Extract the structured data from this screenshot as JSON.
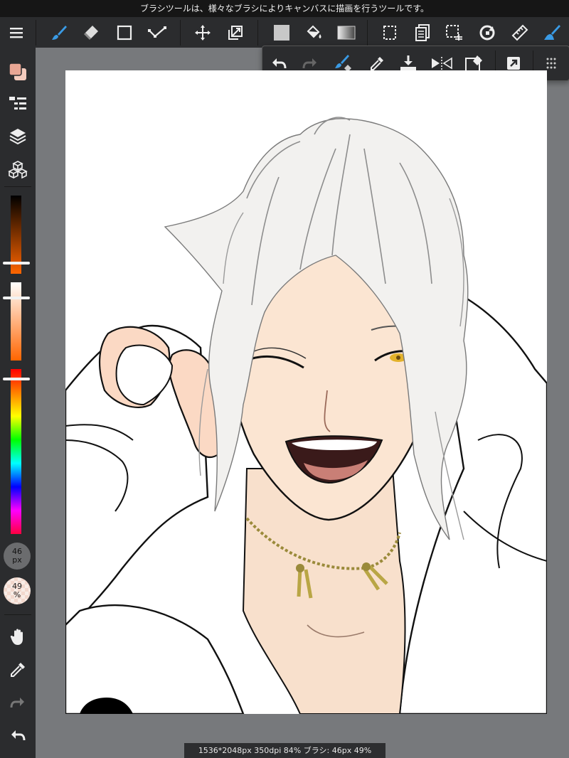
{
  "tooltip": "ブラシツールは、様々なブラシによりキャンバスに描画を行うツールです。",
  "status_text": "1536*2048px 350dpi 84% ブラシ: 46px 49%",
  "brush": {
    "size_line1": "46",
    "size_line2": "px",
    "opacity_line1": "49",
    "opacity_line2": "%"
  },
  "colors": {
    "accent": "#3a9be5",
    "panel": "#2b2c2e",
    "workspace": "#77797c",
    "primary_color": "#e9a694",
    "secondary_color": "#f4cbbd",
    "hue_knob_color": "#ff3b00"
  },
  "topbar_icons": [
    "menu-icon",
    "brush-icon",
    "eraser-icon",
    "shape-icon",
    "line-edit-icon",
    "move-icon",
    "transform-icon",
    "fill-rect-icon",
    "bucket-icon",
    "gradient-icon",
    "select-rect-icon",
    "copy-paste-icon",
    "select-tool-icon",
    "rotate-icon",
    "ruler-icon",
    "brush-settings-icon"
  ],
  "popup_icons": [
    "undo-icon",
    "redo-icon",
    "brush-mode-icon",
    "eyedropper-icon",
    "layer-merge-icon",
    "flip-icon",
    "clear-icon",
    "share-icon",
    "more-icon"
  ],
  "sidebar_icons": [
    "color-swatch-icon",
    "layer-list-icon",
    "layers-icon",
    "materials-icon",
    "hand-icon",
    "eyedropper-icon",
    "redo-icon",
    "undo-icon"
  ],
  "sliders": {
    "brightness": 0.88,
    "saturation": 0.2,
    "hue": 0.06
  }
}
